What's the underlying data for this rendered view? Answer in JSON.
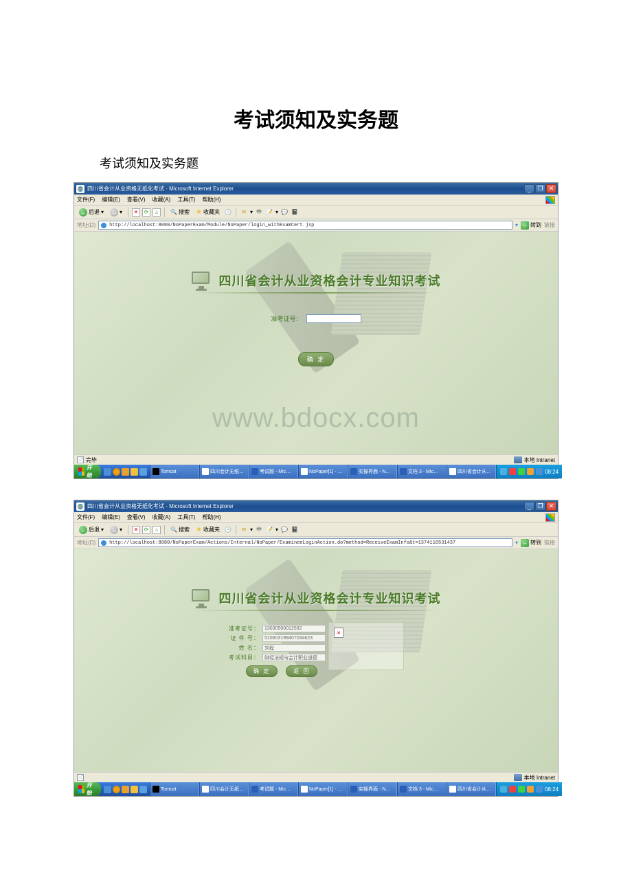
{
  "doc": {
    "title": "考试须知及实务题",
    "subtitle": "考试须知及实务题"
  },
  "watermark": "www.bdocx.com",
  "browser": {
    "window_title": "四川省会计从业资格无纸化考试 - Microsoft Internet Explorer",
    "menu": [
      "文件(F)",
      "编辑(E)",
      "查看(V)",
      "收藏(A)",
      "工具(T)",
      "帮助(H)"
    ],
    "toolbar": {
      "back": "后退",
      "search": "搜索",
      "favorites": "收藏夹"
    },
    "address_label": "地址(D)",
    "go_label": "转到",
    "links_label": "链接",
    "url1": "http://localhost:8080/NoPaperExam/Module/NoPaper/login_withExamCert.jsp",
    "url2": "http://localhost:8080/NoPaperExam/Actions/Internal/NoPaper/ExamineeLoginAction.do?method=ReceiveExamInfo&t=1374110531437"
  },
  "page": {
    "exam_title": "四川省会计从业资格会计专业知识考试",
    "form1": {
      "ticket_label": "准考证号：",
      "submit": "确 定"
    },
    "form2": {
      "ticket_label": "准考证号：",
      "ticket_value": "13030500012592",
      "id_label": "证 件 号：",
      "id_value": "510603199407034623",
      "name_label": "姓    名：",
      "name_value": "刘程",
      "subject_label": "考试科目：",
      "subject_value": "财经法规与会计职业道德",
      "confirm": "确 定",
      "back": "返 回"
    }
  },
  "status": {
    "done": "完毕",
    "intranet": "本地 Intranet"
  },
  "taskbar": {
    "start": "开始",
    "items": [
      "Tomcat",
      "四川会计无纸…",
      "考试题 - Mic…",
      "NoPaper[1] - …",
      "实操界面 - N…",
      "文档 3 - Mic…",
      "四川省会计从…"
    ],
    "time": "08:24"
  }
}
